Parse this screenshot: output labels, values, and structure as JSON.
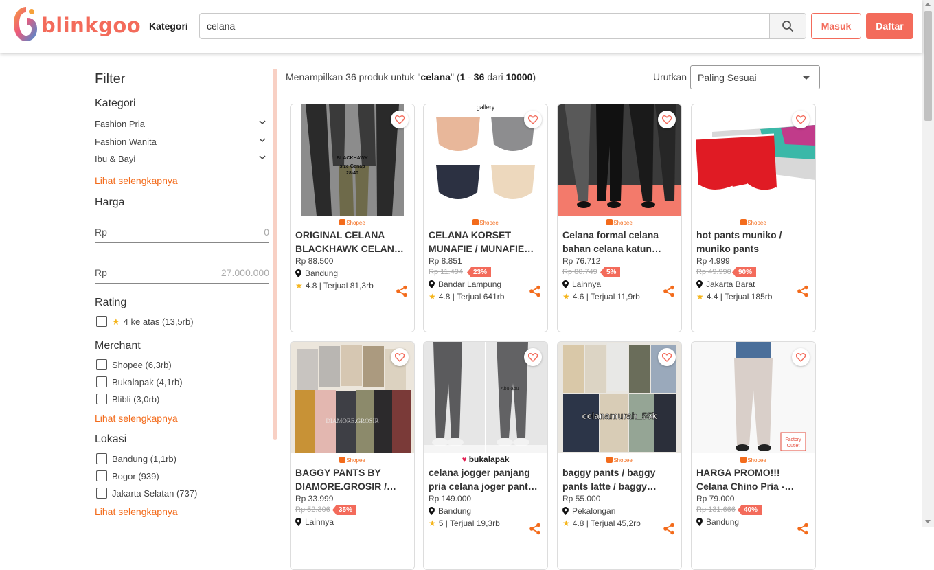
{
  "header": {
    "logo_text": "blinkgoo",
    "kategori_label": "Kategori",
    "search_value": "celana",
    "search_icon": "search-icon",
    "masuk_label": "Masuk",
    "daftar_label": "Daftar",
    "brand_color": "#f36b5b"
  },
  "sidebar": {
    "title": "Filter",
    "kategori": {
      "title": "Kategori",
      "items": [
        "Fashion Pria",
        "Fashion Wanita",
        "Ibu & Bayi"
      ],
      "more": "Lihat selengkapnya"
    },
    "harga": {
      "title": "Harga",
      "min_currency": "Rp",
      "min_value": "0",
      "max_currency": "Rp",
      "max_value": "27.000.000"
    },
    "rating": {
      "title": "Rating",
      "option": "4 ke atas (13,5rb)"
    },
    "merchant": {
      "title": "Merchant",
      "items": [
        "Shopee (6,3rb)",
        "Bukalapak (4,1rb)",
        "Blibli (3,0rb)"
      ],
      "more": "Lihat selengkapnya"
    },
    "lokasi": {
      "title": "Lokasi",
      "items": [
        "Bandung (1,1rb)",
        "Bogor (939)",
        "Jakarta Selatan (737)"
      ],
      "more": "Lihat selengkapnya"
    }
  },
  "results": {
    "prefix": "Menampilkan 36 produk untuk \"",
    "query": "celana",
    "mid1": "\" (",
    "range_start": "1",
    "range_sep": " - ",
    "range_end": "36",
    "mid2": " dari ",
    "total": "10000",
    "suffix": ")",
    "sort_label": "Urutkan",
    "sort_value": "Paling Sesuai"
  },
  "products": [
    {
      "name": "ORIGINAL CELANA BLACKHAWK CELANA PANJANG",
      "merchant": "Shopee",
      "price": "Rp 88.500",
      "old_price": "",
      "discount": "",
      "location": "Bandung",
      "rating": "4.8",
      "sold": "Terjual 81,3rb",
      "img_text": "BLACKHAWK size Genap 28-40"
    },
    {
      "name": "CELANA KORSET MUNAFIE / MUNAFIE SLIMMING PANTS",
      "merchant": "Shopee",
      "price": "Rp 8.851",
      "old_price": "Rp 11.494",
      "discount": "23%",
      "location": "Bandar Lampung",
      "rating": "4.8",
      "sold": "Terjual 641rb",
      "img_text": "gallery"
    },
    {
      "name": "Celana formal celana bahan celana katun Celana kerja",
      "merchant": "Shopee",
      "price": "Rp 76.712",
      "old_price": "Rp 80.749",
      "discount": "5%",
      "location": "Lainnya",
      "rating": "4.6",
      "sold": "Terjual 11,9rb",
      "img_text": ""
    },
    {
      "name": "hot pants muniko / muniko pants",
      "merchant": "Shopee",
      "price": "Rp 4.999",
      "old_price": "Rp 49.990",
      "discount": "90%",
      "location": "Jakarta Barat",
      "rating": "4.4",
      "sold": "Terjual 185rb",
      "img_text": ""
    },
    {
      "name": "BAGGY PANTS BY DIAMORE.GROSIR / CELANA BAGGY",
      "merchant": "Shopee",
      "price": "Rp 33.999",
      "old_price": "Rp 52.306",
      "discount": "35%",
      "location": "Lainnya",
      "rating": "",
      "sold": "",
      "img_text": "DIAMORE.GROSIR"
    },
    {
      "name": "celana jogger panjang pria celana joger pants chino",
      "merchant": "bukalapak",
      "price": "Rp 149.000",
      "old_price": "",
      "discount": "",
      "location": "Bandung",
      "rating": "5",
      "sold": "Terjual 19,3rb",
      "img_text": "Abu-abu"
    },
    {
      "name": "baggy pants / baggy pants latte / baggy pants army",
      "merchant": "Shopee",
      "price": "Rp 55.000",
      "old_price": "",
      "discount": "",
      "location": "Pekalongan",
      "rating": "4.8",
      "sold": "Terjual 45,2rb",
      "img_text": "celanamurah_55k"
    },
    {
      "name": "HARGA PROMO!!! Celana Chino Pria - Celana Panjang",
      "merchant": "Shopee",
      "price": "Rp 79.000",
      "old_price": "Rp 131.666",
      "discount": "40%",
      "location": "Bandung",
      "rating": "",
      "sold": "",
      "img_text": "Factory Outlet"
    }
  ]
}
